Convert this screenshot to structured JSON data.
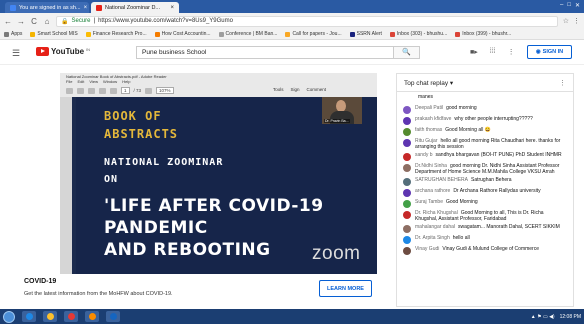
{
  "browser": {
    "tabs": [
      {
        "label": "You are signed in as sh...",
        "color": "#4285f4"
      },
      {
        "label": "National Zoominar D...",
        "color": "#e62117"
      }
    ],
    "window_controls": [
      "–",
      "□",
      "✕"
    ],
    "back": "←",
    "forward": "→",
    "reload": "C",
    "home": "⌂",
    "secure_label": "Secure",
    "url": "https://www.youtube.com/watch?v=8Us9_Y9Gumo",
    "bookmarks": [
      {
        "label": "Apps",
        "color": "#7a7a7a"
      },
      {
        "label": "Smart School MIS",
        "color": "#f4b400"
      },
      {
        "label": "Finance Research Pro...",
        "color": "#fbbc04"
      },
      {
        "label": "How Cost Accountin...",
        "color": "#f57c00"
      },
      {
        "label": "Conference | BM Ban...",
        "color": "#9e9e9e"
      },
      {
        "label": "Call for papers - Jou...",
        "color": "#f9a825"
      },
      {
        "label": "SSRN Alert",
        "color": "#1a237e"
      },
      {
        "label": "Inbox (303) - bhushu...",
        "color": "#db4437"
      },
      {
        "label": "Inbox (399) - bhushr...",
        "color": "#db4437"
      }
    ]
  },
  "youtube": {
    "logo_text": "YouTube",
    "logo_country": "IN",
    "search_value": "Pune business School",
    "search_icon": "search-icon",
    "signin_label": "SIGN IN"
  },
  "video": {
    "window_title": "National Zoominar Book of Abstracts.pdf - Adobe Reader",
    "menu": [
      "File",
      "Edit",
      "View",
      "Window",
      "Help"
    ],
    "page_field": "1",
    "page_total": "/ 73",
    "zoom_field": "107%",
    "right_tools": [
      "Tools",
      "Sign",
      "Comment"
    ],
    "camera_name": "Dr. Pravin Ba...",
    "slide": {
      "line1": "BOOK OF",
      "line2": "ABSTRACTS",
      "line3": "NATIONAL ZOOMINAR",
      "line4": "ON",
      "big1": "'LIFE AFTER COVID-19",
      "big2": "PANDEMIC",
      "big3": "AND REBOOTING"
    },
    "watermark": "zoom"
  },
  "covid": {
    "title": "COVID-19",
    "description": "Get the latest information from the MoHFW about COVID-19.",
    "button": "LEARN MORE"
  },
  "chat": {
    "header": "Top chat replay ▾",
    "more": "⋮",
    "messages": [
      {
        "author": "",
        "text": "manes",
        "color": "#ffffff"
      },
      {
        "author": "Deepali Patil",
        "text": "good morning",
        "color": "#7e57c2"
      },
      {
        "author": "prakash kfidfave",
        "text": "why other people interrupting?????",
        "color": "#5e35b1"
      },
      {
        "author": "faith thomas",
        "text": "Good Morning all 😀",
        "color": "#558b2f"
      },
      {
        "author": "Ritu Gujar",
        "text": "hello all good morning Rita Chaudhari here. thanks for arranging this session",
        "color": "#5e35b1"
      },
      {
        "author": "sandy b",
        "text": "sandhya bhargavan (BOI-IT PUNE) PhD Student INHMR",
        "color": "#c62828"
      },
      {
        "author": "Dr.Nidhi Sinha",
        "text": "good morning Dr. Nidhi Sinha Assistant Professor Department of Home Science M.M.Mahila College VKSU Arrah",
        "color": "#8d6e63"
      },
      {
        "author": "SATRUGHAN BEHERA",
        "text": "Satrughan Behera",
        "color": "#546e7a"
      },
      {
        "author": "archana rathore",
        "text": "Dr Archana Rathore Rallydas university",
        "color": "#5e35b1"
      },
      {
        "author": "Suraj Tambe",
        "text": "Good Morning",
        "color": "#43a047"
      },
      {
        "author": "Dr. Richa Khugshal",
        "text": "Good Morning to all, This is Dr. Richa Khugshal, Assistant Professor, Faridabad",
        "color": "#c62828"
      },
      {
        "author": "mahalangar dahal",
        "text": "swagatam... Manorath Dahal, SCERT SIKKIM",
        "color": "#8d6e63"
      },
      {
        "author": "Dr. Arpita Singh",
        "text": "hello all",
        "color": "#1e88e5"
      },
      {
        "author": "Vinay Gudi",
        "text": "Vinay Gudi & Mulund College of Commerce",
        "color": "#6d4c41"
      }
    ]
  },
  "taskbar": {
    "apps": [
      {
        "name": "ie-icon",
        "color": "#1e88e5"
      },
      {
        "name": "folder-icon",
        "color": "#fbc02d"
      },
      {
        "name": "chrome-icon",
        "color": "#e53935"
      },
      {
        "name": "firefox-icon",
        "color": "#fb8c00"
      },
      {
        "name": "word-icon",
        "color": "#1565c0"
      }
    ],
    "time": "12:08 PM",
    "tray_icons": "▲ ⚑ ▭ ◀)"
  }
}
